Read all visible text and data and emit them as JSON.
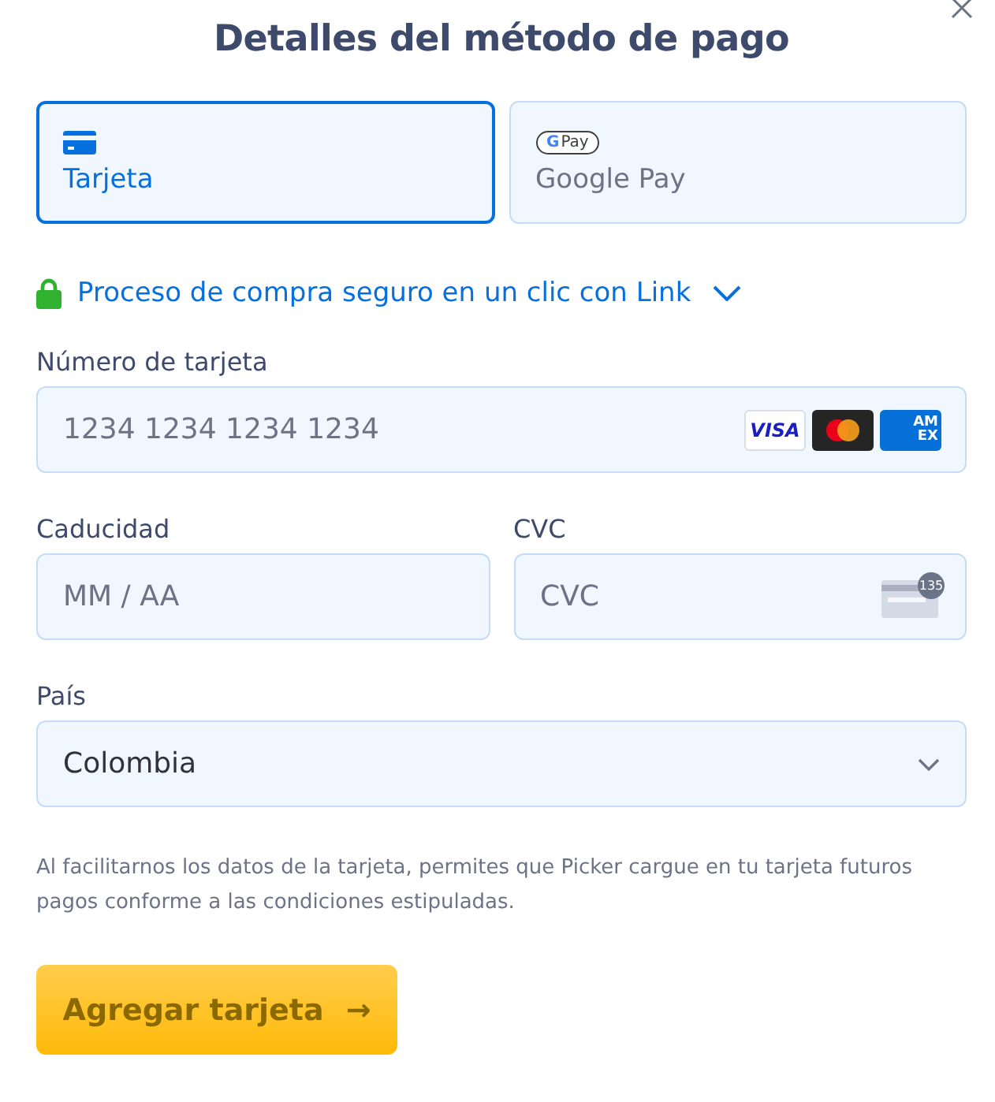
{
  "title": "Detalles del método de pago",
  "tabs": [
    {
      "kind": "card",
      "label": "Tarjeta",
      "selected": true
    },
    {
      "kind": "gpay",
      "label": "Google Pay",
      "logo_g": "G",
      "logo_text": "Pay",
      "selected": false
    }
  ],
  "link": {
    "label": "Proceso de compra seguro en un clic con Link",
    "expanded": false
  },
  "card_number": {
    "label": "Número de tarjeta",
    "placeholder": "1234 1234 1234 1234",
    "brands": [
      {
        "kind": "visa",
        "text": "VISA"
      },
      {
        "kind": "mastercard"
      },
      {
        "kind": "amex",
        "lines": [
          "AM",
          "EX"
        ]
      }
    ]
  },
  "expiry": {
    "label": "Caducidad",
    "placeholder": "MM / AA"
  },
  "cvc": {
    "label": "CVC",
    "placeholder": "CVC",
    "badge": "135"
  },
  "country": {
    "label": "País",
    "value": "Colombia"
  },
  "disclaimer": "Al facilitarnos los datos de la tarjeta, permites que Picker cargue en tu tarjeta futuros pagos conforme a las condiciones estipuladas.",
  "submit": {
    "label": "Agregar tarjeta",
    "arrow": "→"
  }
}
